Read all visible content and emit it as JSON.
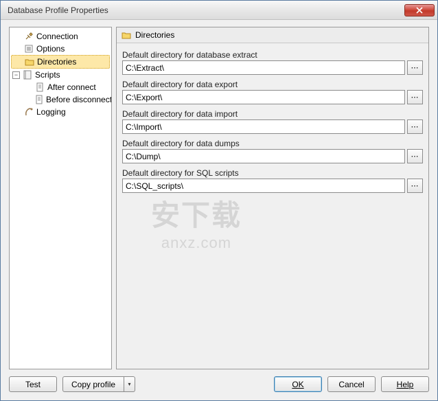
{
  "window": {
    "title": "Database Profile Properties"
  },
  "tree": {
    "items": [
      {
        "label": "Connection",
        "icon": "plug"
      },
      {
        "label": "Options",
        "icon": "options"
      },
      {
        "label": "Directories",
        "icon": "folder",
        "selected": true
      },
      {
        "label": "Scripts",
        "icon": "script",
        "expandable": true
      },
      {
        "label": "After connect",
        "icon": "page",
        "level": 2
      },
      {
        "label": "Before disconnect",
        "icon": "page",
        "level": 2
      },
      {
        "label": "Logging",
        "icon": "log"
      }
    ]
  },
  "panel": {
    "heading": "Directories",
    "fields": [
      {
        "label": "Default directory for database extract",
        "value": "C:\\Extract\\"
      },
      {
        "label": "Default directory for data export",
        "value": "C:\\Export\\"
      },
      {
        "label": "Default directory for data import",
        "value": "C:\\Import\\"
      },
      {
        "label": "Default directory for data dumps",
        "value": "C:\\Dump\\"
      },
      {
        "label": "Default directory for SQL scripts",
        "value": "C:\\SQL_scripts\\"
      }
    ]
  },
  "buttons": {
    "test": "Test",
    "copy": "Copy profile",
    "ok": "OK",
    "cancel": "Cancel",
    "help": "Help"
  },
  "browse_glyph": "⋯",
  "watermark": {
    "line1": "安下载",
    "line2": "anxz.com"
  }
}
